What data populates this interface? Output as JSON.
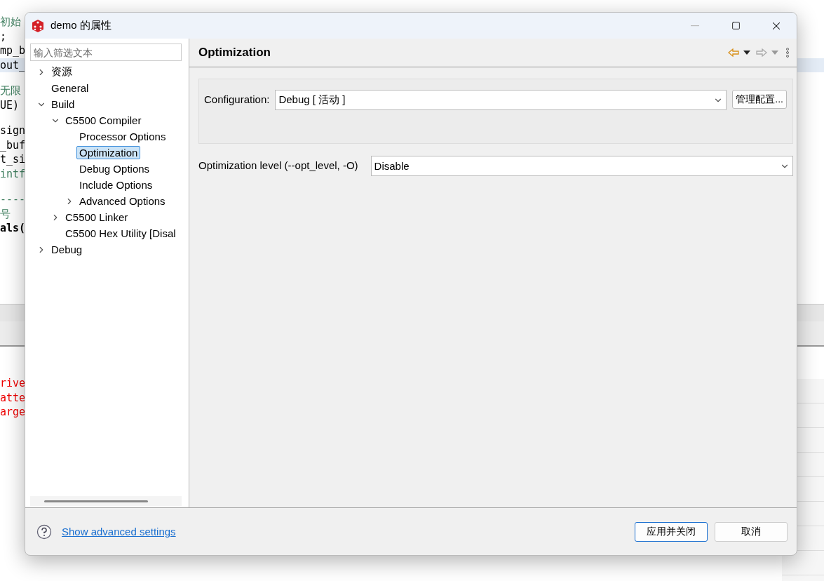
{
  "editor": {
    "blocks": [
      [
        {
          "text": "初始",
          "kind": "comment",
          "current": false
        },
        {
          "text": ";",
          "kind": "code",
          "current": false
        },
        {
          "text": "mp_b",
          "kind": "code",
          "current": false
        },
        {
          "text": "out_",
          "kind": "code",
          "current": true
        }
      ],
      [
        {
          "text": "无限",
          "kind": "comment",
          "current": false
        },
        {
          "text": "UE)",
          "kind": "code",
          "current": false
        }
      ],
      [
        {
          "text": "sign",
          "kind": "code",
          "current": false
        },
        {
          "text": "_buf",
          "kind": "code",
          "current": false
        },
        {
          "text": "t_si",
          "kind": "code",
          "current": false
        },
        {
          "text": "intf",
          "kind": "comment",
          "current": false
        }
      ],
      [
        {
          "text": "----",
          "kind": "comment",
          "current": false
        },
        {
          "text": "号",
          "kind": "comment",
          "current": false
        },
        {
          "text": "als(",
          "kind": "bold",
          "current": false
        }
      ]
    ]
  },
  "console": {
    "lines": [
      "rive",
      "atte",
      "arge"
    ]
  },
  "dialog": {
    "title": "demo 的属性",
    "filter": {
      "placeholder": "输入筛选文本"
    },
    "tree": [
      {
        "label": "资源",
        "expanded": false,
        "selected": false
      },
      {
        "label": "General",
        "selected": false
      },
      {
        "label": "Build",
        "expanded": true,
        "selected": false,
        "children": [
          {
            "label": "C5500 Compiler",
            "expanded": true,
            "selected": false,
            "children": [
              {
                "label": "Processor Options",
                "selected": false
              },
              {
                "label": "Optimization",
                "selected": true
              },
              {
                "label": "Debug Options",
                "selected": false
              },
              {
                "label": "Include Options",
                "selected": false
              },
              {
                "label": "Advanced Options",
                "expanded": false,
                "selected": false
              }
            ]
          },
          {
            "label": "C5500 Linker",
            "expanded": false,
            "selected": false
          },
          {
            "label": "C5500 Hex Utility  [Disal",
            "selected": false
          }
        ]
      },
      {
        "label": "Debug",
        "expanded": false,
        "selected": false
      }
    ],
    "page_title": "Optimization",
    "configuration": {
      "label": "Configuration:",
      "value": "Debug  [ 活动 ]",
      "button": "管理配置..."
    },
    "options": [
      {
        "label": "Optimization level (--opt_level, -O)",
        "value": "Disable"
      }
    ],
    "help_link": "Show advanced settings",
    "buttons": [
      {
        "label": "应用并关闭",
        "primary": true
      },
      {
        "label": "取消",
        "primary": false
      }
    ]
  }
}
